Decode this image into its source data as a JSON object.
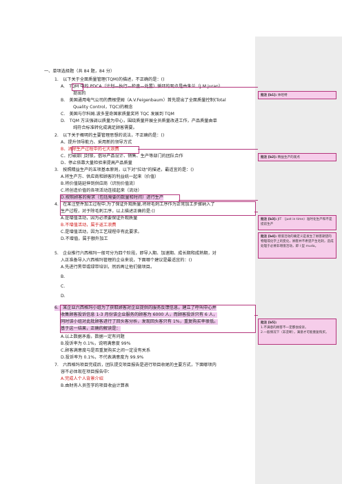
{
  "section_title": "一、单项选择题（共 84 题，84 分）",
  "q1": {
    "stem": "1.　以下关于全面质量管理(TQM)的描述，不正确的是：()",
    "a1": "A.　TQM 中的 PDCA（计划—执行—检查—处置）循环的观点是由朱兰（J.M.juran）",
    "a2": "提出的",
    "b1": "B.　美国通用电气公司的费根堡姆（A.V.Feigenbaum）首先提出了全面质量控制(Total",
    "b2": "Quality Control，TQC)的概念",
    "c": "C.　美国与尔科姆.波多里奇国家质量奖将 TQC 发展到 TQM",
    "d1": "D.　TQM 方法强调以质量为中心，围绕质量开展全员质量改进工作，产品质量由单",
    "d2": "纯符合标准转化成满足顾客需要。"
  },
  "q2": {
    "stem": "2.　以下关于概明的主要管理思想的说法，不正确的是：()",
    "a": "A．提升领导能力、采用新的领导方式",
    "b": "B．消除生产过程中的七大浪费",
    "c": "C．打破部门封锁，倡导产品设计、销售、生产等部门的团队合作",
    "d": "D．停止依靠大量检验来提高产品质量"
  },
  "q3": {
    "stem": "3.　按照精益生产的五项基本原则，以下对\"拉动\"的描述，最适宜的是：()",
    "a": "A.将生产方、供应商和顾客的利益统一起来（价值）",
    "b": "B.将价值链延伸到供应商（识别价值流）",
    "c": "C.将创造价值的各项活动连接起来（流动）",
    "d": "D.按照顾客的需求（包括需要的数量和时间）进行生产"
  },
  "q4": {
    "l1": "4.　在某注塑件加工过程中,为了保证外观质量,将除毛刺工序作为正常加工步骤纳入了",
    "l2": "生产过程，对于除毛刺工序，以上描述正确的是:()",
    "a": "A.是增值活动，因为必须要保证外观质量",
    "b": "B.不增值活动，属于返工浪费",
    "c": "C.是增值活动，因为工艺规程中有此要求。",
    "d": "D.不增值，属于额外加工"
  },
  "q5": {
    "l1": "5.　企业推行六西格玛一般可分为四个阶段，即导入期、加速期、成长期和成熟期，对",
    "l2": "入正准备导入六西格玛管理的企业来说，下面哪个建议是最适宜的：()",
    "a": "A.先进行黑带或绿带培训，然后再让他们做项目。",
    "b": "B.",
    "c": "C.",
    "d": "D."
  },
  "q6": {
    "l1": "6.　某企业六西格玛小组为了获取顾客对企业提供的服务反馈信息，建立了呼叫中心并",
    "l2": "收集顾客投诉信息 1-3 月份该企业服务的顾客为 6000 人，而顾客投诉只有 6 人，",
    "l3": "同时该小组对此批顾客进行了回头客分析，发现回头客只有 1%，重复购买率很低。",
    "l4": "基于这一结果，正确的解读是：",
    "a": "A.以上数据矛盾，数据一定有问题",
    "b": "B.投诉率为 0.1%，说明满意度 99%",
    "c": "C.顾客满意度与是否重复购买之间一定没有关系",
    "d": "D.投诉率为 0.1%，不代表满意度为 99.9%"
  },
  "q7": {
    "l1": "7.　六西格玛项目完成后，团队提交项目报告是进行项目收尾的主要方式，下面哪项内",
    "l2": "容不必体现在项目报告中：",
    "a": "A.完成人个人背景介绍",
    "b": "B.由财务人员签字的项目收益计算表"
  },
  "comments": {
    "c1": {
      "label": "批注 [b1]:",
      "text": "体哈特"
    },
    "c2": {
      "label": "批注 [b2]:",
      "text": "精益生产的观点"
    },
    "c3": {
      "label": "批注 [b3]:",
      "text": "JIT （just in time）准时化生产和不是提前生产"
    },
    "c4": {
      "label": "批注 [b4]:",
      "text": "增值活动的确定义是发生了顾客期望的物理或化学上的变化，顾客并不希望产生毛刺，造成处理于必要非增值活动，即 I 型 muda。"
    },
    "c5": {
      "label": "批注 [b5]:",
      "t1": "1.不满意的顾客不一定都会投诉。",
      "t2": "2.一般情况下（非垄断），满意才可能重复购买。"
    }
  }
}
